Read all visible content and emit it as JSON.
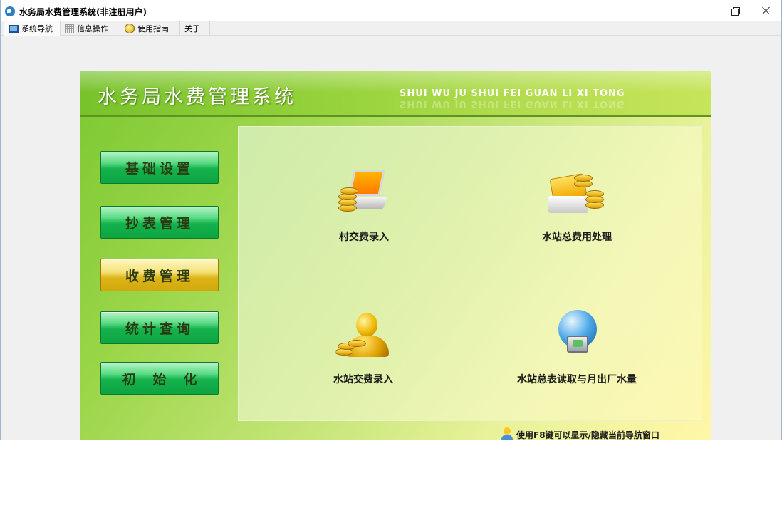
{
  "window": {
    "title": "水务局水费管理系统(非注册用户)"
  },
  "menubar": {
    "items": [
      {
        "label": "系统导航",
        "icon": "monitor-icon"
      },
      {
        "label": "信息操作",
        "icon": "grid-icon"
      },
      {
        "label": "使用指南",
        "icon": "guide-icon"
      },
      {
        "label": "关于",
        "icon": ""
      }
    ]
  },
  "panel": {
    "title": "水务局水费管理系统",
    "subtitle": "SHUI WU JU SHUI FEI GUAN LI XI TONG"
  },
  "nav": {
    "active_index": 2,
    "items": [
      {
        "label": "基础设置"
      },
      {
        "label": "抄表管理"
      },
      {
        "label": "收费管理"
      },
      {
        "label": "统计查询"
      },
      {
        "label": "初始化"
      }
    ]
  },
  "functions": [
    {
      "label": "村交费录入",
      "icon": "laptop-coins-icon"
    },
    {
      "label": "水站总费用处理",
      "icon": "card-coins-icon"
    },
    {
      "label": "水站交费录入",
      "icon": "gold-person-icon"
    },
    {
      "label": "水站总表读取与月出厂水量",
      "icon": "globe-device-icon"
    }
  ],
  "hint": {
    "text": "使用F8键可以显示/隐藏当前导航窗口"
  },
  "colors": {
    "panel_green": "#7cc832",
    "panel_yellow": "#fff7a8",
    "nav_green": "#14b24c",
    "nav_active_gold": "#dcb418"
  }
}
